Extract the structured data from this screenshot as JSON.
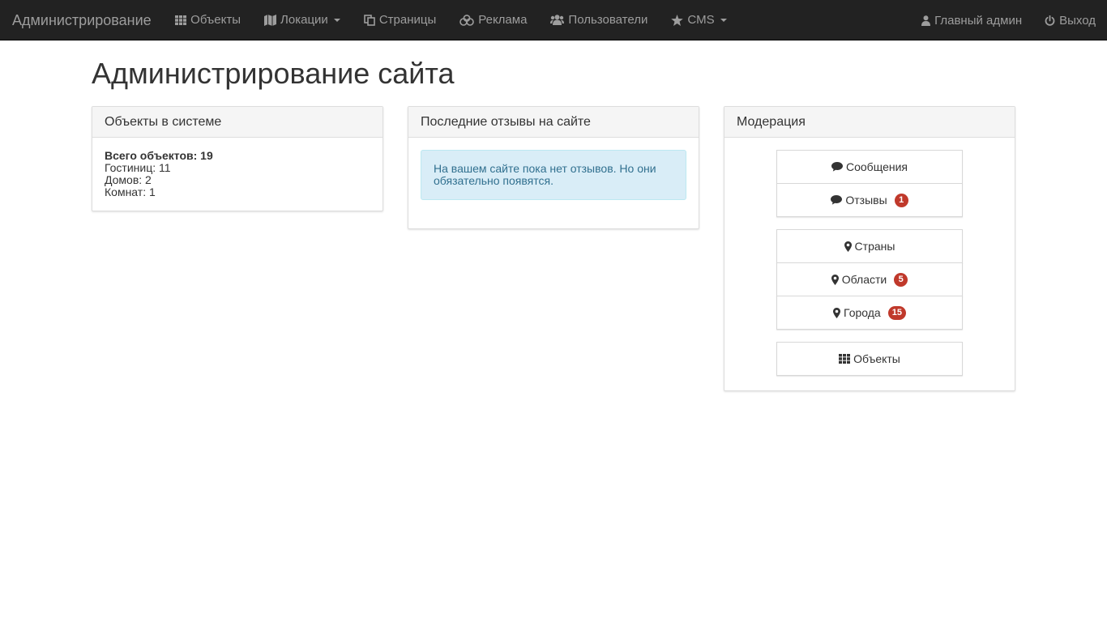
{
  "navbar": {
    "brand": "Администрирование",
    "items": [
      {
        "label": "Объекты",
        "icon": "grid-icon",
        "dropdown": false
      },
      {
        "label": "Локации",
        "icon": "map-icon",
        "dropdown": true
      },
      {
        "label": "Страницы",
        "icon": "copy-icon",
        "dropdown": false
      },
      {
        "label": "Реклама",
        "icon": "bitcoin-stack-icon",
        "dropdown": false
      },
      {
        "label": "Пользователи",
        "icon": "users-icon",
        "dropdown": false
      },
      {
        "label": "CMS",
        "icon": "star-icon",
        "dropdown": true
      }
    ],
    "right": [
      {
        "label": "Главный админ",
        "icon": "user-icon"
      },
      {
        "label": "Выход",
        "icon": "power-icon"
      }
    ]
  },
  "page": {
    "title": "Администрирование сайта"
  },
  "objects_panel": {
    "heading": "Объекты в системе",
    "total": "Всего объектов: 19",
    "hotels": "Гостиниц: 11",
    "houses": "Домов: 2",
    "rooms": "Комнат: 1"
  },
  "reviews_panel": {
    "heading": "Последние отзывы на сайте",
    "alert": "На вашем сайте пока нет отзывов. Но они обязательно появятся."
  },
  "moderation_panel": {
    "heading": "Модерация",
    "messages": {
      "label": "Сообщения",
      "icon": "comment-icon"
    },
    "reviews": {
      "label": "Отзывы",
      "icon": "comment-icon",
      "badge": "1"
    },
    "countries": {
      "label": "Страны",
      "icon": "map-marker-icon"
    },
    "regions": {
      "label": "Области",
      "icon": "map-marker-icon",
      "badge": "5"
    },
    "cities": {
      "label": "Города",
      "icon": "map-marker-icon",
      "badge": "15"
    },
    "objects": {
      "label": "Объекты",
      "icon": "grid-icon"
    }
  },
  "colors": {
    "navbar_bg": "#222222",
    "navbar_text": "#9d9d9d",
    "badge": "#c0392b",
    "alert_bg": "#d9edf7",
    "alert_text": "#31708f"
  }
}
